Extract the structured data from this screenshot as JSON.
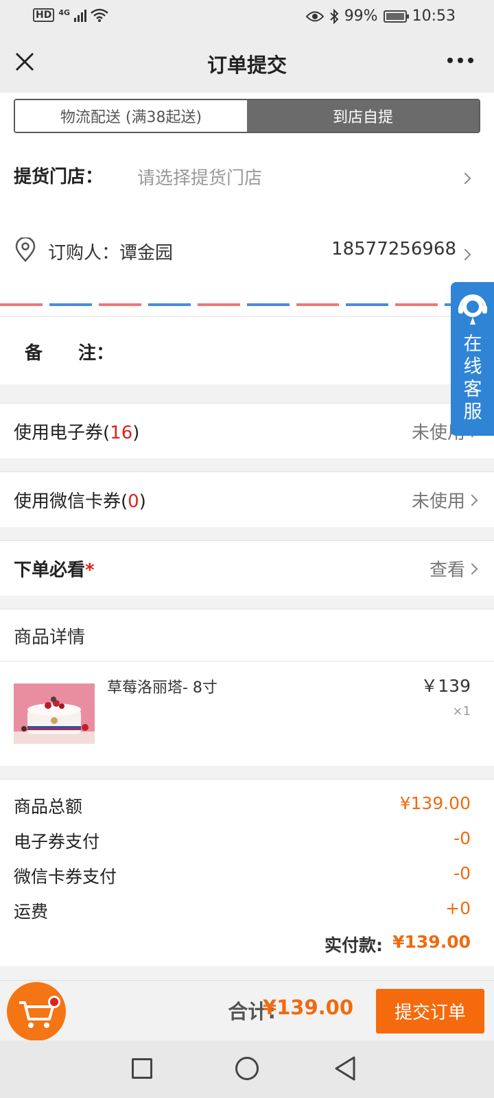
{
  "status": {
    "network": "4G",
    "battery": "99%",
    "time": "10:53",
    "hd": "HD"
  },
  "nav": {
    "title": "订单提交"
  },
  "delivery_tabs": [
    {
      "label": "物流配送 (满38起送)",
      "selected": false
    },
    {
      "label": "到店自提",
      "selected": true
    }
  ],
  "store": {
    "label": "提货门店：",
    "placeholder": "请选择提货门店"
  },
  "buyer": {
    "label": "订购人：谭金园",
    "phone": "18577256968"
  },
  "remark": {
    "label": "备　　注："
  },
  "coupon": {
    "label": "使用电子券(",
    "count": "16",
    "close": ")",
    "status": "未使用"
  },
  "wxcard": {
    "label": "使用微信卡券(",
    "count": "0",
    "close": ")",
    "status": "未使用"
  },
  "must_read": {
    "label": "下单必看",
    "star": "*",
    "action": "查看"
  },
  "goods": {
    "header": "商品详情",
    "items": [
      {
        "name": "草莓洛丽塔- 8寸",
        "price": "￥139",
        "qty": "×1"
      }
    ]
  },
  "summary": {
    "rows": [
      {
        "label": "商品总额",
        "value": "¥139.00"
      },
      {
        "label": "电子券支付",
        "value": "-0"
      },
      {
        "label": "微信卡券支付",
        "value": "-0"
      },
      {
        "label": "运费",
        "value": "+0"
      }
    ],
    "paid_label": "实付款:",
    "paid_value": "¥139.00"
  },
  "bottom": {
    "total_label": "合计:",
    "total_value": "¥139.00",
    "submit": "提交订单"
  },
  "service": {
    "text": "在线客服"
  },
  "colors": {
    "accent": "#f56a0c",
    "price": "#f06a0f",
    "red": "#e0211c",
    "service": "#2f84d6"
  }
}
